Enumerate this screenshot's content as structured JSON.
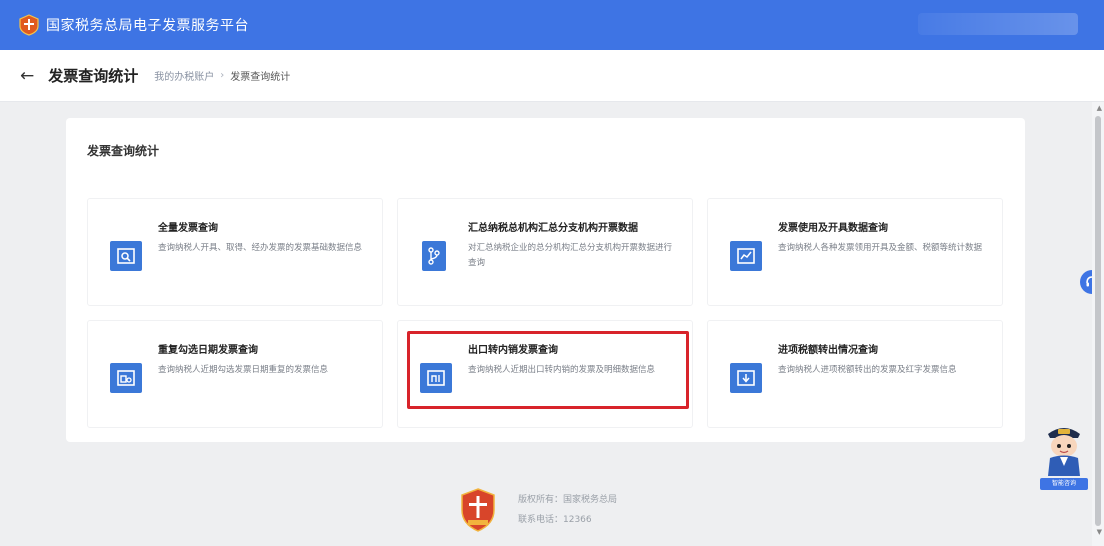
{
  "header": {
    "title": "国家税务总局电子发票服务平台"
  },
  "subheader": {
    "back_label": "←",
    "page_title": "发票查询统计",
    "breadcrumb": [
      "我的办税账户",
      "发票查询统计"
    ],
    "breadcrumb_sep": "›"
  },
  "panel": {
    "title": "发票查询统计"
  },
  "cards": [
    {
      "title": "全量发票查询",
      "desc": "查询纳税人开具、取得、经办发票的发票基础数据信息",
      "icon": "search-doc-icon"
    },
    {
      "title": "汇总纳税总机构汇总分支机构开票数据",
      "desc": "对汇总纳税企业的总分机构汇总分支机构开票数据进行查询",
      "icon": "branch-icon"
    },
    {
      "title": "发票使用及开具数据查询",
      "desc": "查询纳税人各种发票领用开具及金额、税额等统计数据",
      "icon": "chart-doc-icon"
    },
    {
      "title": "重复勾选日期发票查询",
      "desc": "查询纳税人近期勾选发票日期重复的发票信息",
      "icon": "calendar-doc-icon"
    },
    {
      "title": "出口转内销发票查询",
      "desc": "查询纳税人近期出口转内销的发票及明细数据信息",
      "icon": "export-doc-icon"
    },
    {
      "title": "进项税额转出情况查询",
      "desc": "查询纳税人进项税额转出的发票及红字发票信息",
      "icon": "transfer-doc-icon"
    }
  ],
  "footer": {
    "line1": "版权所有：国家税务总局",
    "line2": "联系电话：12366"
  },
  "assistant": {
    "label": "智能咨询"
  },
  "colors": {
    "primary": "#3e74e4",
    "icon_bg": "#3b78d8",
    "highlight": "#d8232a"
  }
}
